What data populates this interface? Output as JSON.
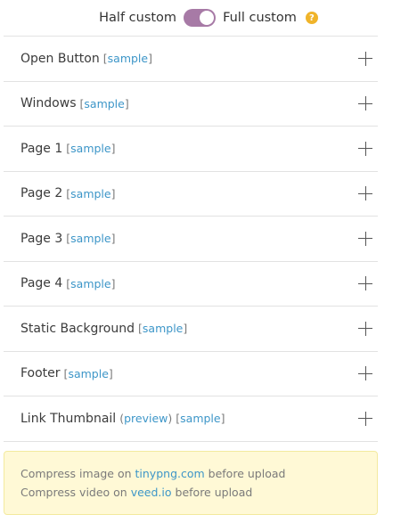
{
  "mode": {
    "left_label": "Half custom",
    "right_label": "Full custom",
    "help_glyph": "?",
    "state": "full"
  },
  "sections": [
    {
      "label": "Open Button",
      "sample": "sample"
    },
    {
      "label": "Windows",
      "sample": "sample"
    },
    {
      "label": "Page 1",
      "sample": "sample"
    },
    {
      "label": "Page 2",
      "sample": "sample"
    },
    {
      "label": "Page 3",
      "sample": "sample"
    },
    {
      "label": "Page 4",
      "sample": "sample"
    },
    {
      "label": "Static Background",
      "sample": "sample"
    },
    {
      "label": "Footer",
      "sample": "sample"
    },
    {
      "label": "Link Thumbnail",
      "preview": "preview",
      "sample": "sample"
    }
  ],
  "notice": {
    "line1_pre": "Compress image on",
    "line1_link": "tinypng.com",
    "line1_post": "before upload",
    "line2_pre": "Compress video on",
    "line2_link": "veed.io",
    "line2_post": "before upload"
  },
  "colors": {
    "toggle": "#a77aa6",
    "link": "#3d96c8",
    "help_badge": "#f0b42a",
    "notice_bg": "#fff9d6"
  }
}
